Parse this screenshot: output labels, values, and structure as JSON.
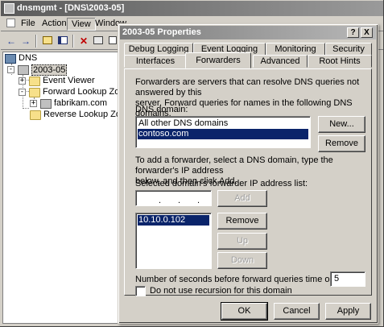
{
  "main": {
    "title": "dnsmgmt - [DNS\\2003-05]",
    "menu": [
      "File",
      "Action",
      "View",
      "Window"
    ],
    "tree": {
      "root": "DNS",
      "server": "2003-05",
      "event_viewer": "Event Viewer",
      "forward_zones": "Forward Lookup Zones",
      "zone": "fabrikam.com",
      "reverse_zones": "Reverse Lookup Zones"
    }
  },
  "dialog": {
    "title": "2003-05 Properties",
    "help_button": "?",
    "close_button": "X",
    "tabs_row1": [
      "Debug Logging",
      "Event Logging",
      "Monitoring",
      "Security"
    ],
    "tabs_row2": [
      "Interfaces",
      "Forwarders",
      "Advanced",
      "Root Hints"
    ],
    "active_tab": "Forwarders",
    "description": [
      "Forwarders are servers that can resolve DNS queries not answered by this",
      "server. Forward queries for names in the following DNS domains."
    ],
    "dns_domain_label": "DNS domain:",
    "domains": [
      "All other DNS domains",
      "contoso.com"
    ],
    "selected_domain": "contoso.com",
    "new_button": "New...",
    "remove_domain_button": "Remove",
    "instructions": [
      "To add a forwarder, select a DNS domain, type the forwarder's IP address",
      "below, and then click Add."
    ],
    "ip_list_label": "Selected domain's forwarder IP address list:",
    "ip_input": "",
    "add_button": "Add",
    "ip_addresses": [
      "10.10.0.102"
    ],
    "remove_ip_button": "Remove",
    "up_button": "Up",
    "down_button": "Down",
    "timeout_label": "Number of seconds before forward queries time out:",
    "timeout_value": "5",
    "no_recursion_label": "Do not use recursion for this domain",
    "no_recursion_checked": false,
    "ok_button": "OK",
    "cancel_button": "Cancel",
    "apply_button": "Apply"
  }
}
